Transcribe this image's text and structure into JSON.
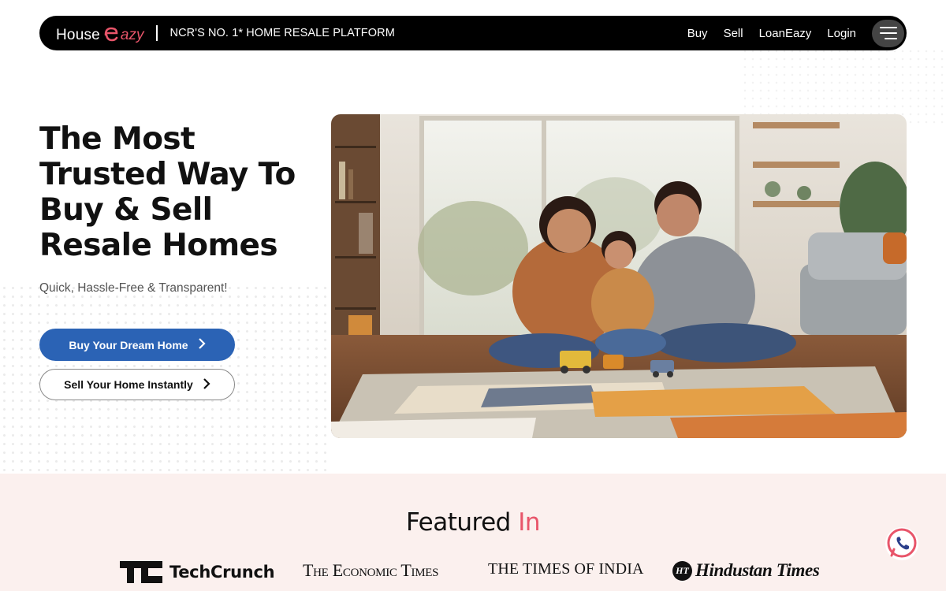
{
  "navbar": {
    "logo_part1": "House",
    "logo_part2": "azy",
    "tagline": "NCR'S NO. 1* HOME RESALE PLATFORM",
    "links": [
      "Buy",
      "Sell",
      "LoanEazy",
      "Login"
    ],
    "menu_icon": "hamburger-icon"
  },
  "hero": {
    "title": "The Most Trusted Way To Buy & Sell Resale Homes",
    "subtitle": "Quick, Hassle-Free & Transparent!",
    "primary_cta": "Buy Your Dream Home",
    "secondary_cta": "Sell Your Home Instantly",
    "image_icon": "family-home-photo"
  },
  "featured": {
    "title_main": "Featured ",
    "title_accent": "In",
    "logos": {
      "techcrunch": "TechCrunch",
      "economic_times": "The Economic Times",
      "times_of_india": "THE TIMES OF INDIA",
      "hindustan_times_badge": "HT",
      "hindustan_times": "Hindustan Times"
    }
  },
  "floating": {
    "whatsapp_icon": "whatsapp-icon"
  },
  "colors": {
    "brand_accent": "#e8556a",
    "primary_button": "#2b63b5",
    "navbar_bg": "#000000",
    "featured_bg": "#fbf0ee"
  }
}
